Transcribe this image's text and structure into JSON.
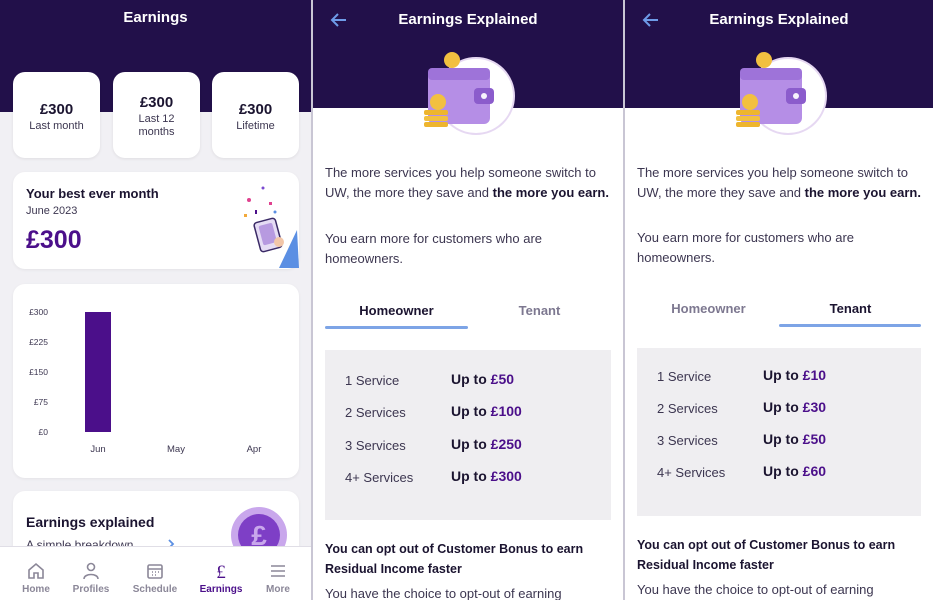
{
  "earnings": {
    "title": "Earnings",
    "stats": [
      {
        "value": "£300",
        "label": "Last month"
      },
      {
        "value": "£300",
        "label": "Last 12 months"
      },
      {
        "value": "£300",
        "label": "Lifetime"
      }
    ],
    "best": {
      "title": "Your best ever month",
      "date": "June 2023",
      "amount": "£300"
    },
    "explained": {
      "title": "Earnings explained",
      "subtitle": "A simple breakdown"
    },
    "nav": [
      {
        "label": "Home",
        "icon": "home-icon"
      },
      {
        "label": "Profiles",
        "icon": "person-icon"
      },
      {
        "label": "Schedule",
        "icon": "calendar-icon"
      },
      {
        "label": "Earnings",
        "icon": "pound-icon",
        "active": true
      },
      {
        "label": "More",
        "icon": "menu-icon"
      }
    ]
  },
  "chart_data": {
    "type": "bar",
    "categories": [
      "Jun",
      "May",
      "Apr"
    ],
    "values": [
      300,
      0,
      0
    ],
    "yticks": [
      "£300",
      "£225",
      "£150",
      "£75",
      "£0"
    ],
    "ylim": [
      0,
      300
    ],
    "bar_color": "#4b0f8a",
    "grid": false
  },
  "explained": {
    "title": "Earnings Explained",
    "para1_a": "The more services you help someone switch to UW, the more they save and ",
    "para1_b": "the more you earn.",
    "para2": "You earn more for customers who are homeowners.",
    "tabs": [
      "Homeowner",
      "Tenant"
    ],
    "homeowner_rows": [
      {
        "service": "1 Service",
        "prefix": "Up to ",
        "amount": "£50"
      },
      {
        "service": "2 Services",
        "prefix": "Up to ",
        "amount": "£100"
      },
      {
        "service": "3 Services",
        "prefix": "Up to ",
        "amount": "£250"
      },
      {
        "service": "4+ Services",
        "prefix": "Up to ",
        "amount": "£300"
      }
    ],
    "tenant_rows": [
      {
        "service": "1 Service",
        "prefix": "Up to ",
        "amount": "£10"
      },
      {
        "service": "2 Services",
        "prefix": "Up to ",
        "amount": "£30"
      },
      {
        "service": "3 Services",
        "prefix": "Up to ",
        "amount": "£50"
      },
      {
        "service": "4+ Services",
        "prefix": "Up to ",
        "amount": "£60"
      }
    ],
    "opt_out_heading": "You can opt out of Customer Bonus to earn Residual Income faster",
    "opt_out_text": "You have the choice to opt-out of earning"
  },
  "colors": {
    "header": "#22104a",
    "accent": "#4b0f8a",
    "tab_underline": "#7da4e6"
  }
}
